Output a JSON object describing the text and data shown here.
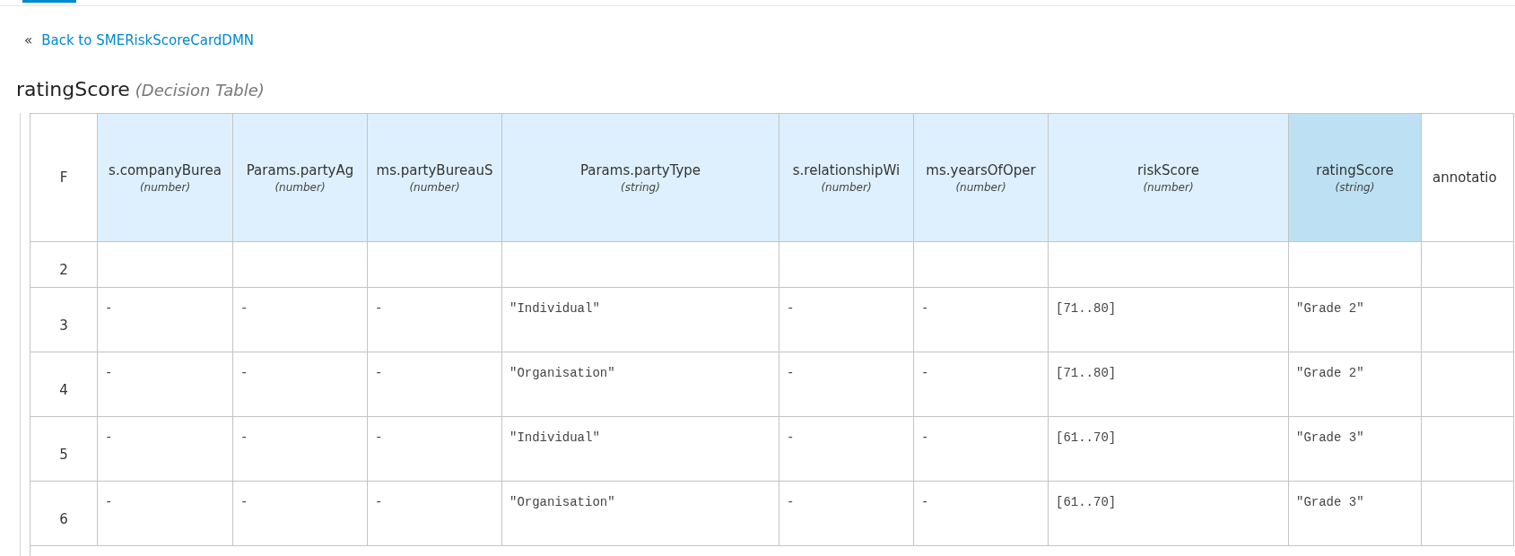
{
  "back_link": {
    "icon": "«",
    "label": "Back to SMERiskScoreCardDMN"
  },
  "title": {
    "name": "ratingScore",
    "kind": "(Decision Table)"
  },
  "table": {
    "hit_policy": "F",
    "columns": [
      {
        "label": "s.companyBurea",
        "type": "(number)",
        "kind": "input"
      },
      {
        "label": "Params.partyAg",
        "type": "(number)",
        "kind": "input"
      },
      {
        "label": "ms.partyBureauS",
        "type": "(number)",
        "kind": "input"
      },
      {
        "label": "Params.partyType",
        "type": "(string)",
        "kind": "input"
      },
      {
        "label": "s.relationshipWi",
        "type": "(number)",
        "kind": "input"
      },
      {
        "label": "ms.yearsOfOper",
        "type": "(number)",
        "kind": "input"
      },
      {
        "label": "riskScore",
        "type": "(number)",
        "kind": "input"
      },
      {
        "label": "ratingScore",
        "type": "(string)",
        "kind": "output"
      },
      {
        "label": "annotatio",
        "kind": "annotation"
      }
    ],
    "rows": [
      {
        "number": "2",
        "cells": [
          "",
          "",
          "",
          "",
          "",
          "",
          "",
          "",
          ""
        ]
      },
      {
        "number": "3",
        "cells": [
          "-",
          "-",
          "-",
          "\"Individual\"",
          "-",
          "-",
          "[71..80]",
          "\"Grade 2\"",
          ""
        ]
      },
      {
        "number": "4",
        "cells": [
          "-",
          "-",
          "-",
          "\"Organisation\"",
          "-",
          "-",
          "[71..80]",
          "\"Grade 2\"",
          ""
        ]
      },
      {
        "number": "5",
        "cells": [
          "-",
          "-",
          "-",
          "\"Individual\"",
          "-",
          "-",
          "[61..70]",
          "\"Grade 3\"",
          ""
        ]
      },
      {
        "number": "6",
        "cells": [
          "-",
          "-",
          "-",
          "\"Organisation\"",
          "-",
          "-",
          "[61..70]",
          "\"Grade 3\"",
          ""
        ]
      }
    ]
  }
}
